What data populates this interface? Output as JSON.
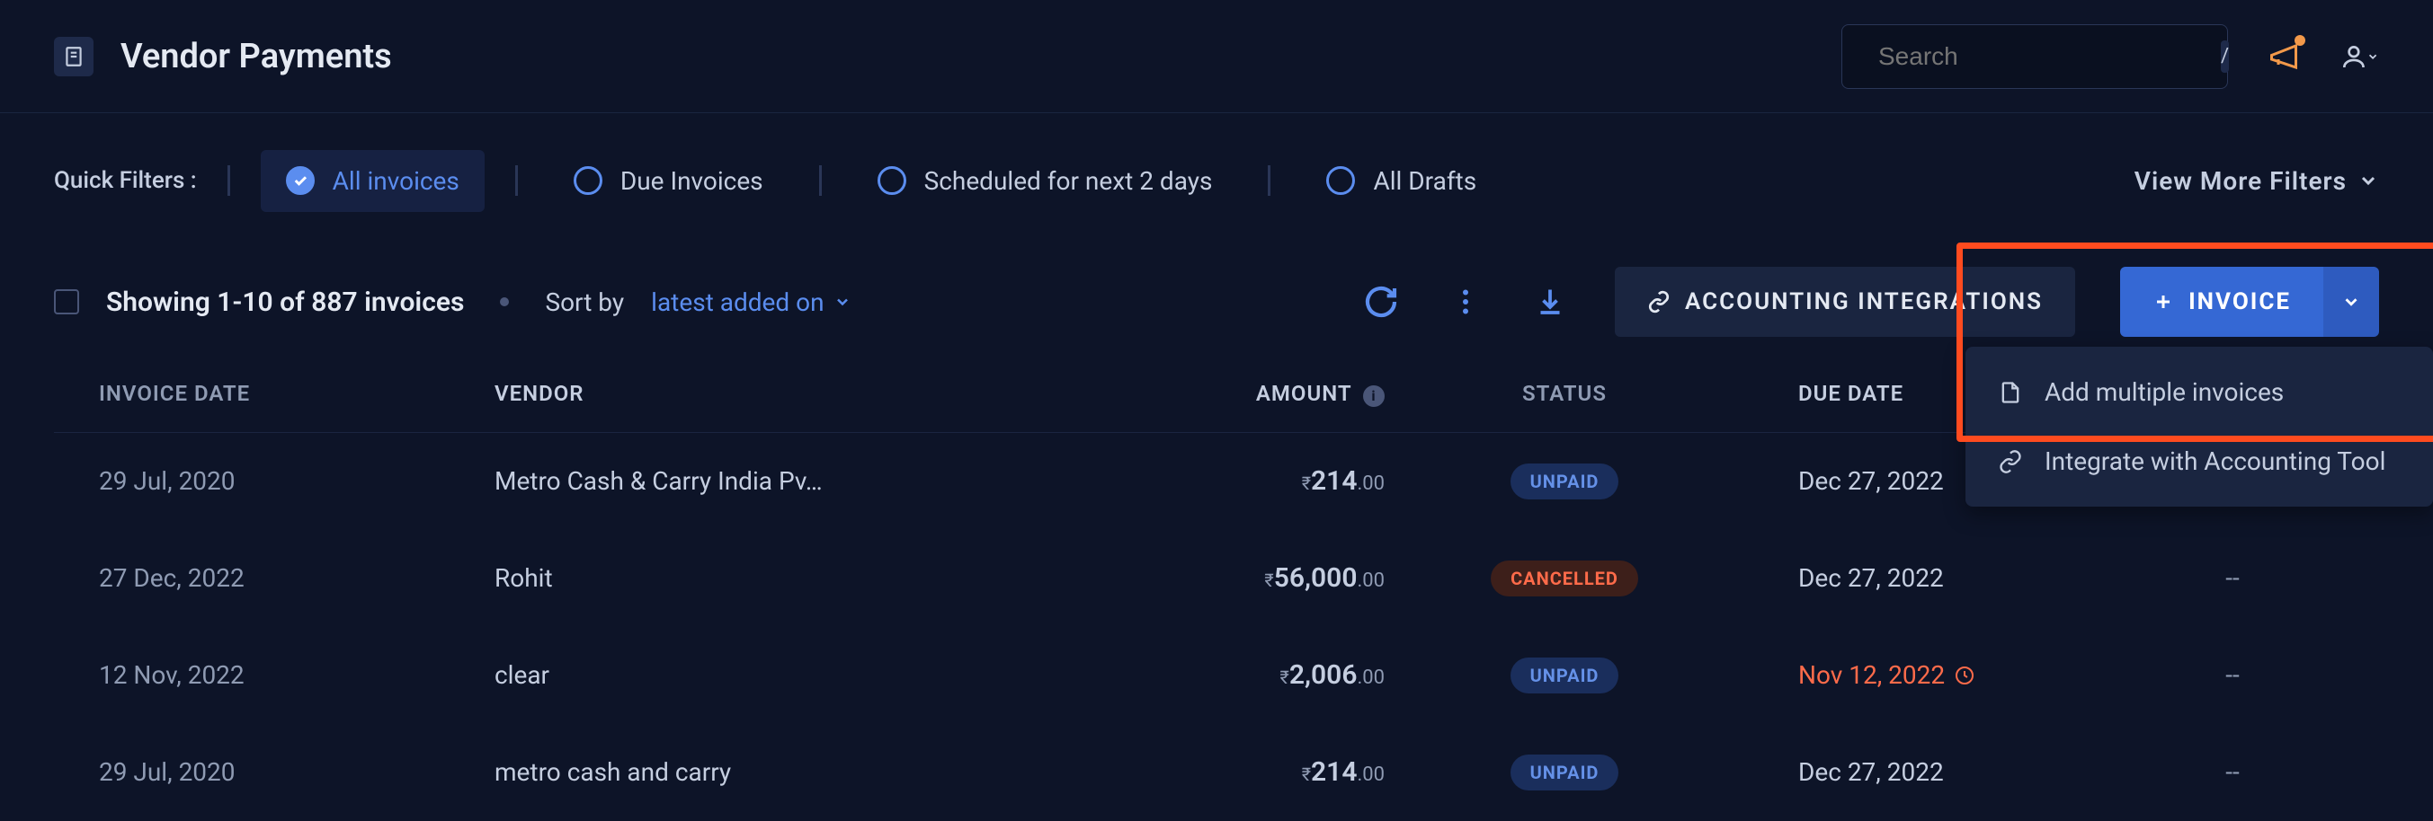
{
  "header": {
    "title": "Vendor Payments",
    "search_placeholder": "Search",
    "search_kbd": "/"
  },
  "filters": {
    "label": "Quick Filters :",
    "items": [
      {
        "label": "All invoices",
        "active": true
      },
      {
        "label": "Due Invoices",
        "active": false
      },
      {
        "label": "Scheduled for next 2 days",
        "active": false
      },
      {
        "label": "All Drafts",
        "active": false
      }
    ],
    "view_more": "View More Filters"
  },
  "toolbar": {
    "showing": "Showing 1-10 of 887 invoices",
    "sort_label": "Sort by",
    "sort_value": "latest added on",
    "accounting_integrations": "ACCOUNTING INTEGRATIONS",
    "invoice_btn": "INVOICE"
  },
  "dropdown": {
    "items": [
      {
        "label": "Add multiple invoices",
        "icon": "document"
      },
      {
        "label": "Integrate with Accounting Tool",
        "icon": "link"
      }
    ]
  },
  "table": {
    "headers": {
      "invoice_date": "INVOICE DATE",
      "vendor": "VENDOR",
      "amount": "AMOUNT",
      "status": "STATUS",
      "due_date": "DUE DATE"
    },
    "rows": [
      {
        "date": "29 Jul, 2020",
        "vendor": "Metro Cash & Carry India Pv…",
        "amount_whole": "214",
        "amount_dec": ".00",
        "status": "UNPAID",
        "status_type": "unpaid",
        "due": "Dec 27, 2022",
        "overdue": false,
        "actions": ""
      },
      {
        "date": "27 Dec, 2022",
        "vendor": "Rohit",
        "amount_whole": "56,000",
        "amount_dec": ".00",
        "status": "CANCELLED",
        "status_type": "cancelled",
        "due": "Dec 27, 2022",
        "overdue": false,
        "actions": "--"
      },
      {
        "date": "12 Nov, 2022",
        "vendor": "clear",
        "amount_whole": "2,006",
        "amount_dec": ".00",
        "status": "UNPAID",
        "status_type": "unpaid",
        "due": "Nov 12, 2022",
        "overdue": true,
        "actions": "--"
      },
      {
        "date": "29 Jul, 2020",
        "vendor": "metro cash and carry",
        "amount_whole": "214",
        "amount_dec": ".00",
        "status": "UNPAID",
        "status_type": "unpaid",
        "due": "Dec 27, 2022",
        "overdue": false,
        "actions": "--"
      }
    ]
  }
}
